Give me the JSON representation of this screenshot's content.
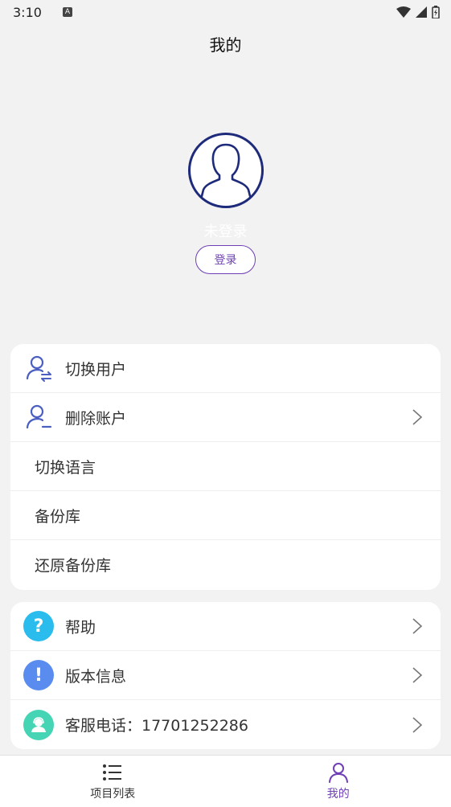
{
  "status_bar": {
    "time": "3:10",
    "notif_letter": "A"
  },
  "header": {
    "title": "我的"
  },
  "profile": {
    "status_text": "未登录",
    "login_label": "登录"
  },
  "settings": [
    {
      "label": "切换用户",
      "icon": "switch-user-icon",
      "chevron": false
    },
    {
      "label": "删除账户",
      "icon": "delete-user-icon",
      "chevron": true
    },
    {
      "label": "切换语言",
      "icon": null,
      "chevron": false
    },
    {
      "label": "备份库",
      "icon": null,
      "chevron": false
    },
    {
      "label": "还原备份库",
      "icon": null,
      "chevron": false
    }
  ],
  "info": [
    {
      "label": "帮助",
      "icon": "help-icon",
      "glyph": "?",
      "color": "#2bbcee",
      "chevron": true
    },
    {
      "label": "版本信息",
      "icon": "info-icon",
      "glyph": "!",
      "color": "#5a8cf0",
      "chevron": true
    },
    {
      "label": "客服电话：17701252286",
      "icon": "support-icon",
      "glyph": "",
      "color": "#45d4b4",
      "chevron": true
    }
  ],
  "bottom_nav": [
    {
      "label": "项目列表",
      "icon": "list-icon",
      "active": false
    },
    {
      "label": "我的",
      "icon": "person-icon",
      "active": true
    }
  ],
  "colors": {
    "accent": "#6f3fb5",
    "background": "#f2f2f2",
    "avatar_ring": "#1e2a7a",
    "user_icon": "#4a5fc1"
  }
}
